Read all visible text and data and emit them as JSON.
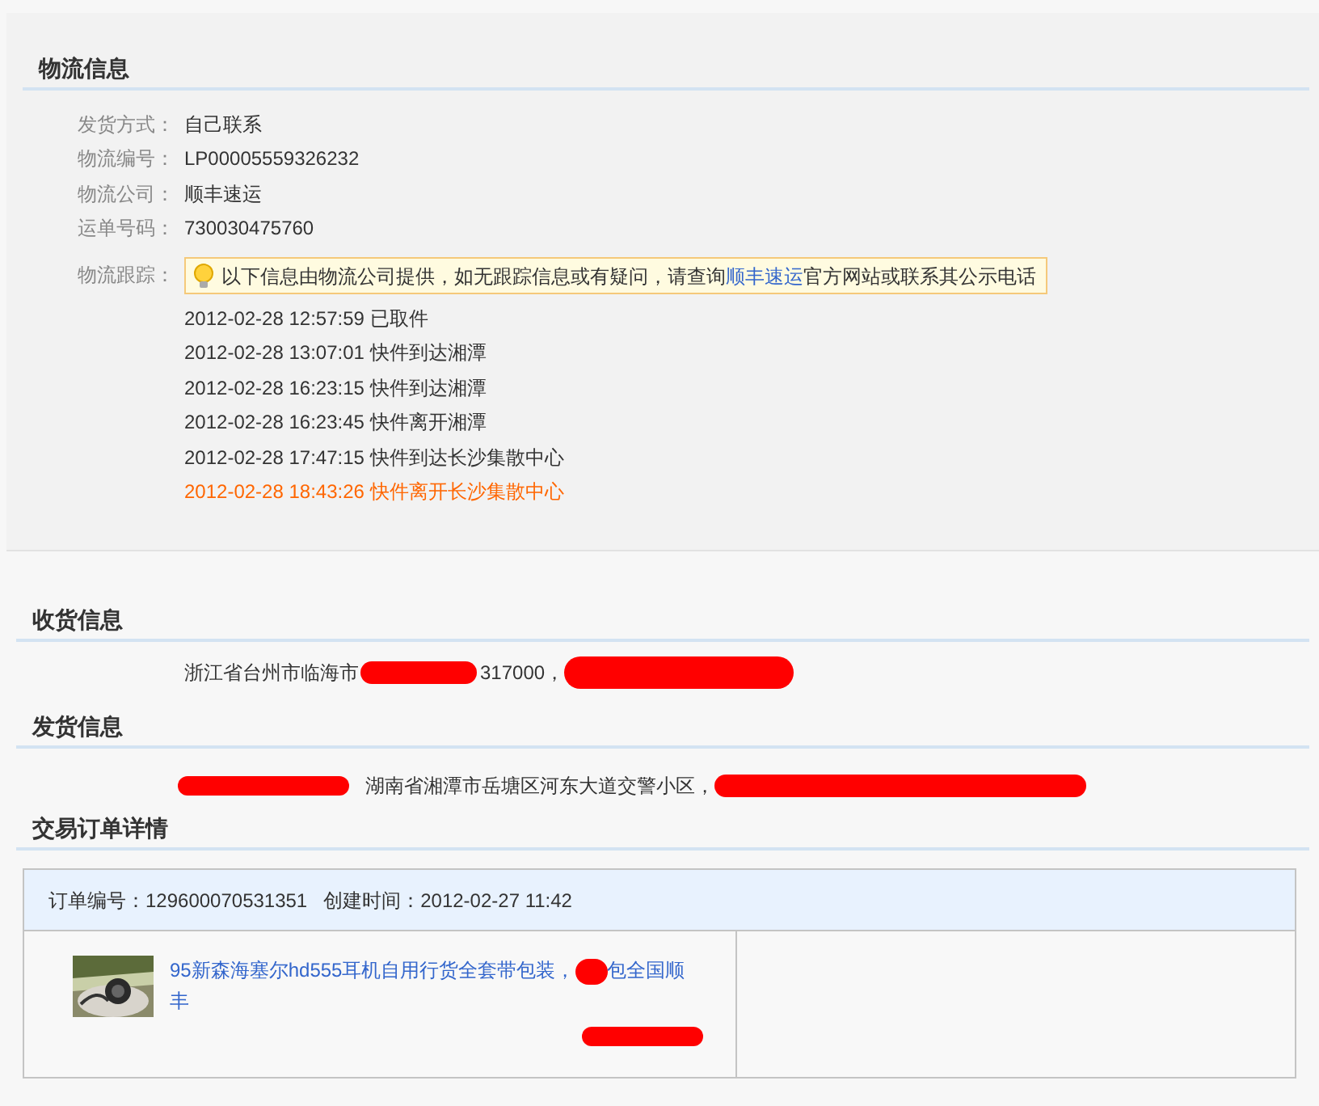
{
  "logistics": {
    "heading": "物流信息",
    "fields": [
      {
        "label": "发货方式：",
        "value": "自己联系"
      },
      {
        "label": "物流编号：",
        "value": "LP00005559326232"
      },
      {
        "label": "物流公司：",
        "value": "顺丰速运"
      },
      {
        "label": "运单号码：",
        "value": "730030475760"
      }
    ],
    "tracking_label": "物流跟踪：",
    "notice": {
      "before": "以下信息由物流公司提供，如无跟踪信息或有疑问，请查询",
      "link": "顺丰速运",
      "after": "官方网站或联系其公示电话"
    },
    "events": [
      {
        "time": "2012-02-28 12:57:59",
        "text": "已取件",
        "latest": false
      },
      {
        "time": "2012-02-28 13:07:01",
        "text": "快件到达湘潭",
        "latest": false
      },
      {
        "time": "2012-02-28 16:23:15",
        "text": "快件到达湘潭",
        "latest": false
      },
      {
        "time": "2012-02-28 16:23:45",
        "text": "快件离开湘潭",
        "latest": false
      },
      {
        "time": "2012-02-28 17:47:15",
        "text": "快件到达长沙集散中心",
        "latest": false
      },
      {
        "time": "2012-02-28 18:43:26",
        "text": "快件离开长沙集散中心",
        "latest": true
      }
    ]
  },
  "receiver": {
    "heading": "收货信息",
    "address_start": "浙江省台州市临海市",
    "postcode": "317000，"
  },
  "sender": {
    "heading": "发货信息",
    "address": "湖南省湘潭市岳塘区河东大道交警小区，"
  },
  "order": {
    "heading": "交易订单详情",
    "number_label": "订单编号：",
    "number": "129600070531351",
    "created_label": "创建时间：",
    "created": "2012-02-27 11:42",
    "item": {
      "title_start": "95新森海塞尔hd555耳机自用行货全套带包装，",
      "title_end": "包全国顺丰"
    }
  }
}
